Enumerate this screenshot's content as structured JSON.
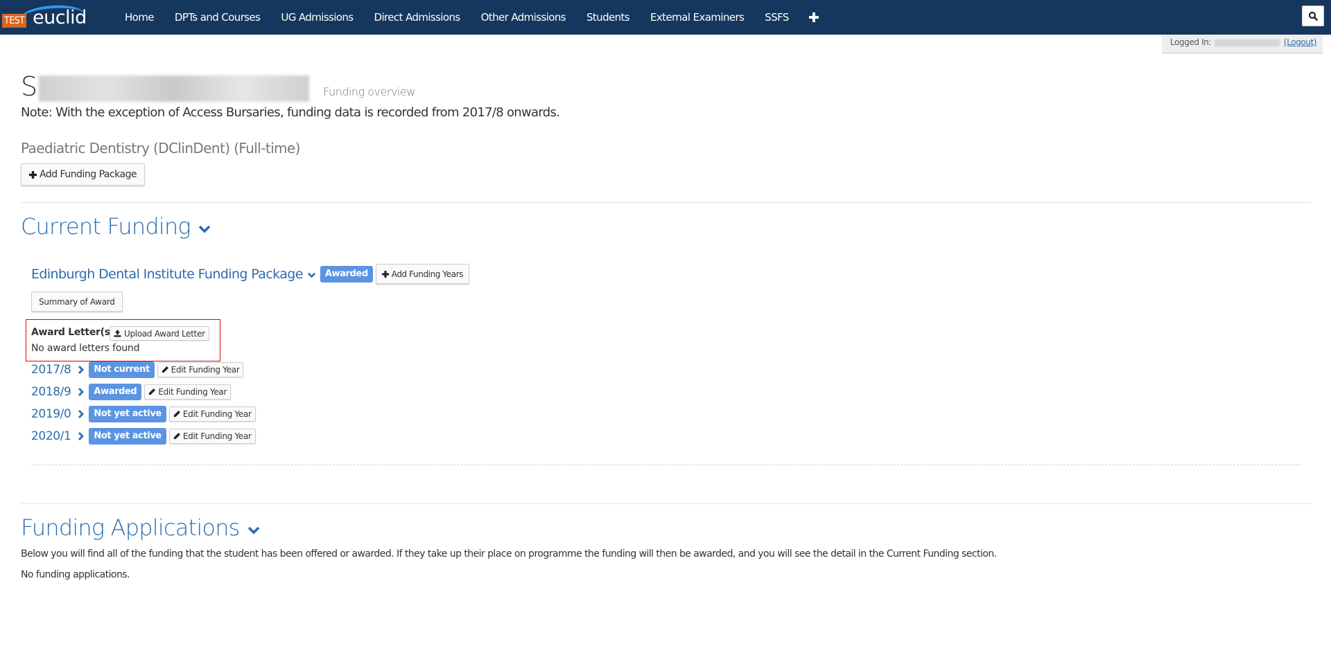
{
  "brand": {
    "test_label": "TEST",
    "name": "euclid"
  },
  "nav": {
    "items": [
      {
        "label": "Home"
      },
      {
        "label": "DPTs and Courses"
      },
      {
        "label": "UG Admissions"
      },
      {
        "label": "Direct Admissions"
      },
      {
        "label": "Other Admissions"
      },
      {
        "label": "Students"
      },
      {
        "label": "External Examiners"
      },
      {
        "label": "SSFS"
      }
    ],
    "plus_icon": "plus-icon",
    "search_icon": "search-icon"
  },
  "session": {
    "logged_in_label": "Logged In:",
    "logout_label": "(Logout)"
  },
  "header": {
    "title_initial": "S",
    "subtitle": "Funding overview",
    "note": "Note: With the exception of Access Bursaries, funding data is recorded from 2017/8 onwards.",
    "programme": "Paediatric Dentistry (DClinDent) (Full-time)",
    "add_package_label": "Add Funding Package"
  },
  "current_funding": {
    "title": "Current Funding",
    "package": {
      "name": "Edinburgh Dental Institute Funding Package",
      "status": "Awarded",
      "add_years_label": "Add Funding Years",
      "summary_label": "Summary of Award",
      "award_letters_title": "Award Letter(s)",
      "upload_label": "Upload Award Letter",
      "no_letters": "No award letters found",
      "years": [
        {
          "year": "2017/8",
          "status": "Not current",
          "edit_label": "Edit Funding Year"
        },
        {
          "year": "2018/9",
          "status": "Awarded",
          "edit_label": "Edit Funding Year"
        },
        {
          "year": "2019/0",
          "status": "Not yet active",
          "edit_label": "Edit Funding Year"
        },
        {
          "year": "2020/1",
          "status": "Not yet active",
          "edit_label": "Edit Funding Year"
        }
      ]
    }
  },
  "funding_applications": {
    "title": "Funding Applications",
    "description": "Below you will find all of the funding that the student has been offered or awarded. If they take up their place on programme the funding will then be awarded, and you will see the detail in the Current Funding section.",
    "empty": "No funding applications."
  },
  "colors": {
    "navbar": "#16375d",
    "accent": "#2b6cad",
    "badge": "#5b94e0",
    "highlight_border": "#e00000",
    "test_badge": "#d9651f"
  }
}
